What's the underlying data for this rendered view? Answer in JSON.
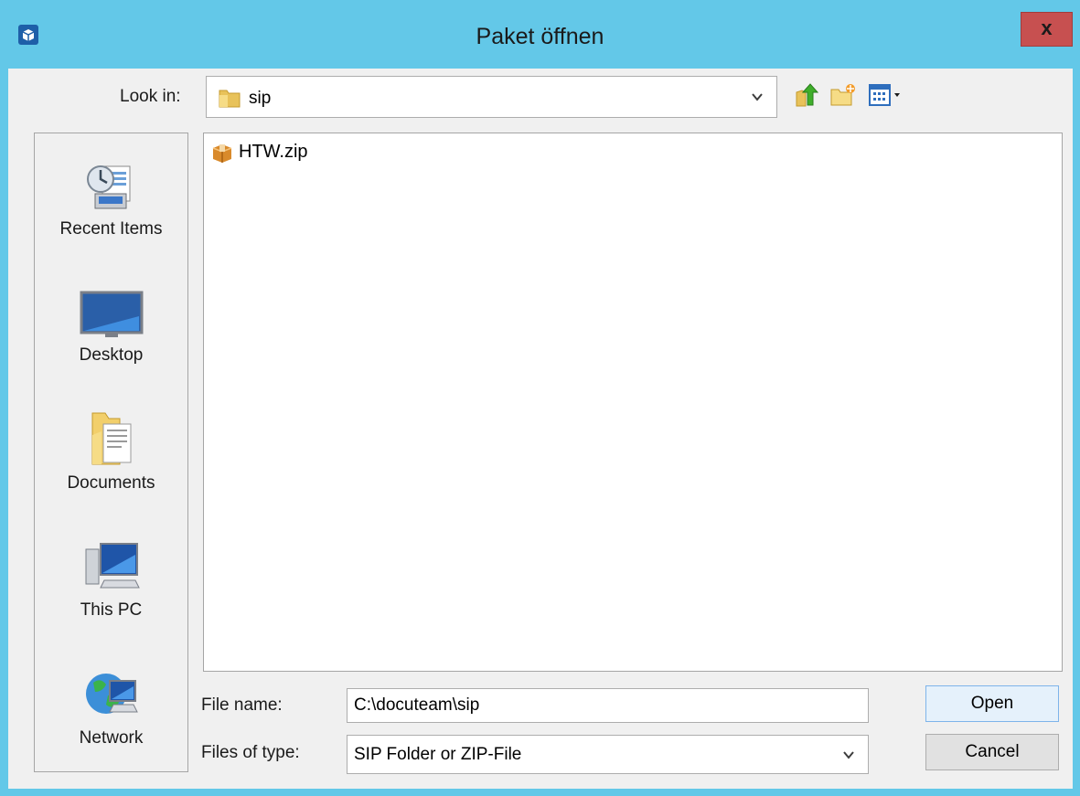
{
  "window": {
    "title": "Paket öffnen",
    "close_label": "x"
  },
  "lookin": {
    "label": "Look in:",
    "value": "sip"
  },
  "toolbar": {
    "icons": [
      "up-one-level-icon",
      "new-folder-icon",
      "view-menu-icon"
    ]
  },
  "places": [
    {
      "label": "Recent Items",
      "icon": "recent-items-icon"
    },
    {
      "label": "Desktop",
      "icon": "desktop-icon"
    },
    {
      "label": "Documents",
      "icon": "documents-icon"
    },
    {
      "label": "This PC",
      "icon": "computer-icon"
    },
    {
      "label": "Network",
      "icon": "network-icon"
    }
  ],
  "files": [
    {
      "name": "HTW.zip",
      "icon": "package-icon"
    }
  ],
  "filename": {
    "label": "File name:",
    "value": "C:\\docuteam\\sip"
  },
  "filetype": {
    "label": "Files of type:",
    "value": "SIP Folder or ZIP-File"
  },
  "buttons": {
    "open": "Open",
    "cancel": "Cancel"
  },
  "colors": {
    "titlebar": "#63c8e8",
    "close": "#c75050",
    "client": "#f0f0f0"
  }
}
